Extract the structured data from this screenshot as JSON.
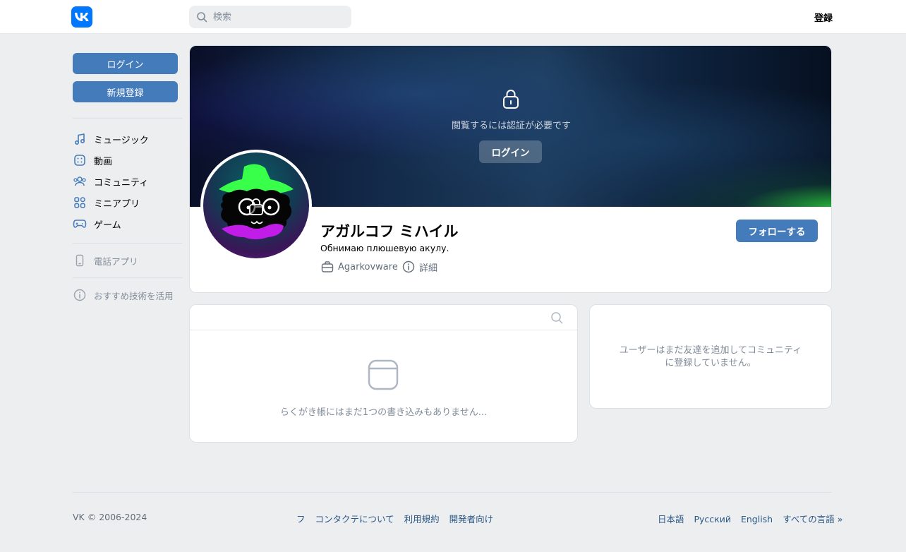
{
  "header": {
    "search_placeholder": "検索",
    "register_label": "登録"
  },
  "sidebar": {
    "login_label": "ログイン",
    "signup_label": "新規登録",
    "items": [
      {
        "label": "ミュージック",
        "icon": "music-icon"
      },
      {
        "label": "動画",
        "icon": "video-icon"
      },
      {
        "label": "コミュニティ",
        "icon": "community-icon"
      },
      {
        "label": "ミニアプリ",
        "icon": "mini-apps-icon"
      },
      {
        "label": "ゲーム",
        "icon": "gamepad-icon"
      }
    ],
    "phone_app_label": "電話アプリ",
    "recommend_label": "おすすめ技術を活用"
  },
  "profile": {
    "cover_notice": "閲覧するには認証が必要です",
    "cover_login_label": "ログイン",
    "name": "アガルコフ ミハイル",
    "status": "Обнимаю плюшевую акулу.",
    "work": "Agarkovware",
    "details_label": "詳細",
    "follow_label": "フォローする"
  },
  "wall": {
    "empty_text": "らくがき帳にはまだ1つの書き込みもありません..."
  },
  "friends": {
    "empty_text": "ユーザーはまだ友達を追加してコミュニティに登録していません。"
  },
  "footer": {
    "copyright": "VK © 2006-2024",
    "links": [
      "フ",
      "コンタクテについて",
      "利用規約",
      "開発者向け"
    ],
    "languages": [
      "日本語",
      "Русский",
      "English",
      "すべての言語 »"
    ]
  },
  "colors": {
    "accent": "#447bba",
    "brand": "#0077ff",
    "background": "#edeef0"
  }
}
